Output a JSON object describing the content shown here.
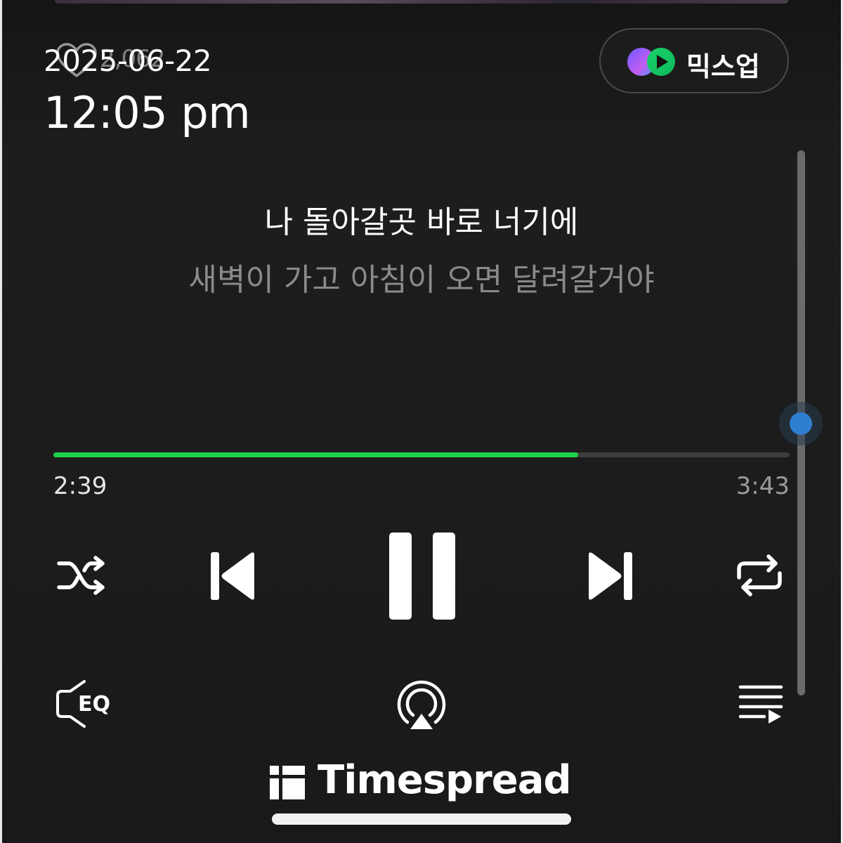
{
  "header": {
    "like_count": "2,062",
    "date": "2025-06-22",
    "time": "12:05 pm",
    "mixup_label": "믹스업"
  },
  "lyrics": {
    "current": "나 돌아갈곳 바로 너기에",
    "next": "새벽이 가고 아침이 오면 달려갈거야"
  },
  "playback": {
    "elapsed": "2:39",
    "total": "3:43",
    "progress_fraction": 0.713,
    "state": "playing"
  },
  "controls": {
    "shuffle_icon": "shuffle-icon",
    "prev_icon": "skip-previous-icon",
    "pause_icon": "pause-icon",
    "next_icon": "skip-next-icon",
    "repeat_icon": "repeat-icon",
    "eq_label": "EQ",
    "airplay_icon": "airplay-icon",
    "playlist_icon": "playlist-icon"
  },
  "lyrics_scroll": {
    "position_fraction": 0.5
  },
  "watermark": {
    "text": "Timespread"
  },
  "colors": {
    "background": "#1c1c1c",
    "progress": "#1ed14a",
    "scroll_knob": "#2f7fd0",
    "lyric_current": "#ffffff",
    "lyric_next": "#8a8a8a"
  }
}
